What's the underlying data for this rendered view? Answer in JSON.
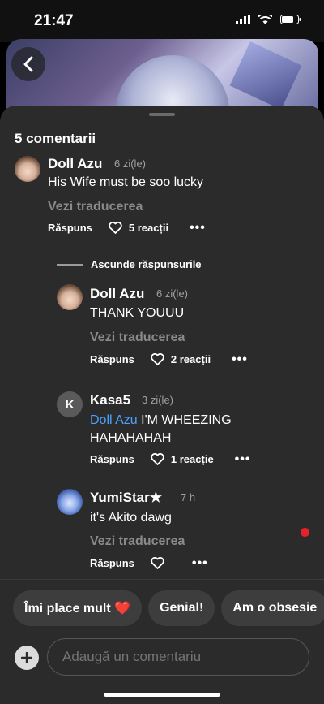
{
  "status": {
    "time": "21:47"
  },
  "sheet": {
    "title": "5 comentarii"
  },
  "comments": [
    {
      "name": "Doll Azu",
      "ago": "6 zi(le)",
      "text": "His Wife must be soo lucky",
      "translate": "Vezi traducerea",
      "reply": "Răspuns",
      "reactions": "5 reacții"
    },
    {
      "name": "Doll Azu",
      "ago": "6 zi(le)",
      "text": "THANK YOUUU",
      "translate": "Vezi traducerea",
      "reply": "Răspuns",
      "reactions": "2 reacții"
    },
    {
      "name": "Kasa5",
      "avatar_letter": "K",
      "ago": "3 zi(le)",
      "mention": "Doll Azu",
      "text": " I'M WHEEZING HAHAHAHAH",
      "reply": "Răspuns",
      "reactions": "1 reacție"
    },
    {
      "name": "YumiStar★",
      "ago": "7 h",
      "text": "it's Akito dawg",
      "translate": "Vezi traducerea",
      "reply": "Răspuns"
    }
  ],
  "hide_replies": "Ascunde răspunsurile",
  "chips": [
    "Îmi place mult ❤️",
    "Genial!",
    "Am o obsesie"
  ],
  "composer": {
    "placeholder": "Adaugă un comentariu"
  },
  "colors": {
    "mention": "#4aa3ff",
    "notification_dot": "#e8202a",
    "sheet_bg": "#2b2b2b"
  }
}
